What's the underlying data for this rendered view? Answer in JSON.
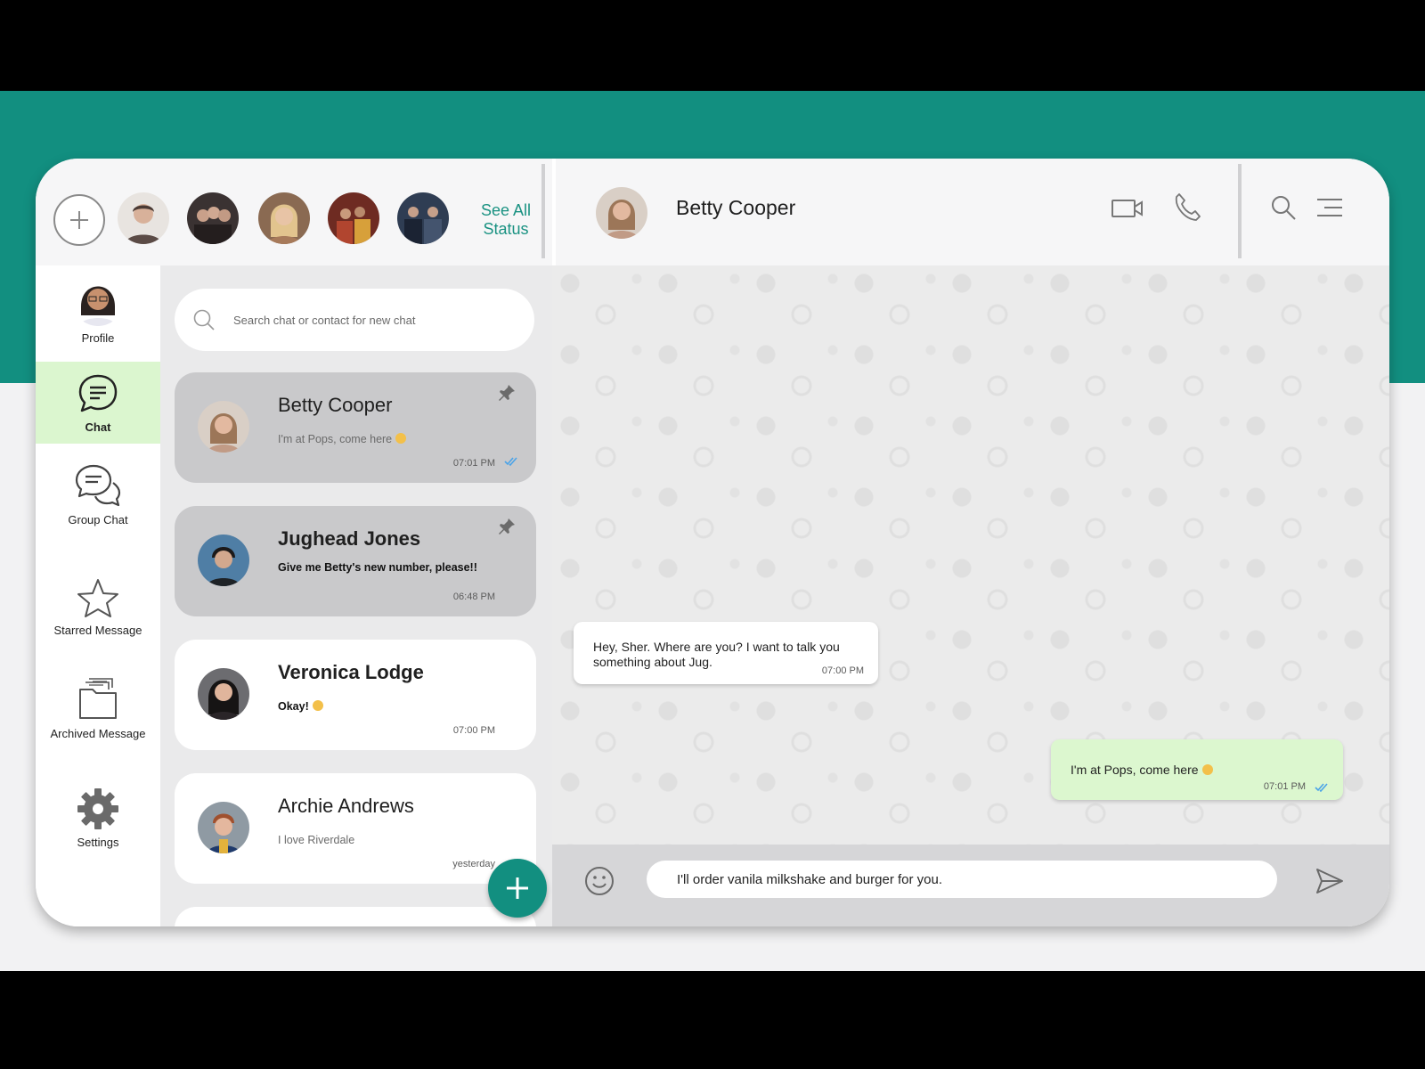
{
  "status_bar": {
    "see_all": "See All Status",
    "statuses": [
      {
        "name": "status-1",
        "color": "#5b4b46"
      },
      {
        "name": "status-2",
        "color": "#3a3232"
      },
      {
        "name": "status-3",
        "color": "#a77a5a"
      },
      {
        "name": "status-4",
        "color": "#6e2b22"
      },
      {
        "name": "status-5",
        "color": "#2f3d53"
      }
    ]
  },
  "chat_header": {
    "name": "Betty Cooper",
    "icons": [
      "video-call-icon",
      "phone-icon",
      "search-icon",
      "menu-icon"
    ]
  },
  "nav": {
    "profile": "Profile",
    "chat": "Chat",
    "group_chat": "Group Chat",
    "starred": "Starred Message",
    "archived": "Archived Message",
    "settings": "Settings"
  },
  "search": {
    "placeholder": "Search chat or contact for new chat"
  },
  "chats": [
    {
      "name": "Betty Cooper",
      "message": "I'm at Pops, come here",
      "time": "07:01 PM",
      "pinned": true,
      "read": true
    },
    {
      "name": "Jughead Jones",
      "message": "Give me Betty's new number, please!!",
      "time": "06:48 PM",
      "pinned": true,
      "read": false
    },
    {
      "name": "Veronica Lodge",
      "message": "Okay!",
      "time": "07:00 PM",
      "pinned": false,
      "read": false
    },
    {
      "name": "Archie Andrews",
      "message": "I love Riverdale",
      "time": "yesterday",
      "pinned": false,
      "read": false
    }
  ],
  "conversation": {
    "incoming": {
      "text": "Hey, Sher. Where are you? I want to talk you something about Jug.",
      "time": "07:00 PM"
    },
    "outgoing": {
      "text": "I'm at Pops, come here",
      "time": "07:01 PM"
    }
  },
  "composer": {
    "value": "I'll order vanila milkshake and burger for you."
  },
  "colors": {
    "brand": "#128f80",
    "active_nav": "#dbf6cf",
    "outgoing_bubble": "#dcf7cf",
    "read_tick": "#4aa3e8"
  }
}
